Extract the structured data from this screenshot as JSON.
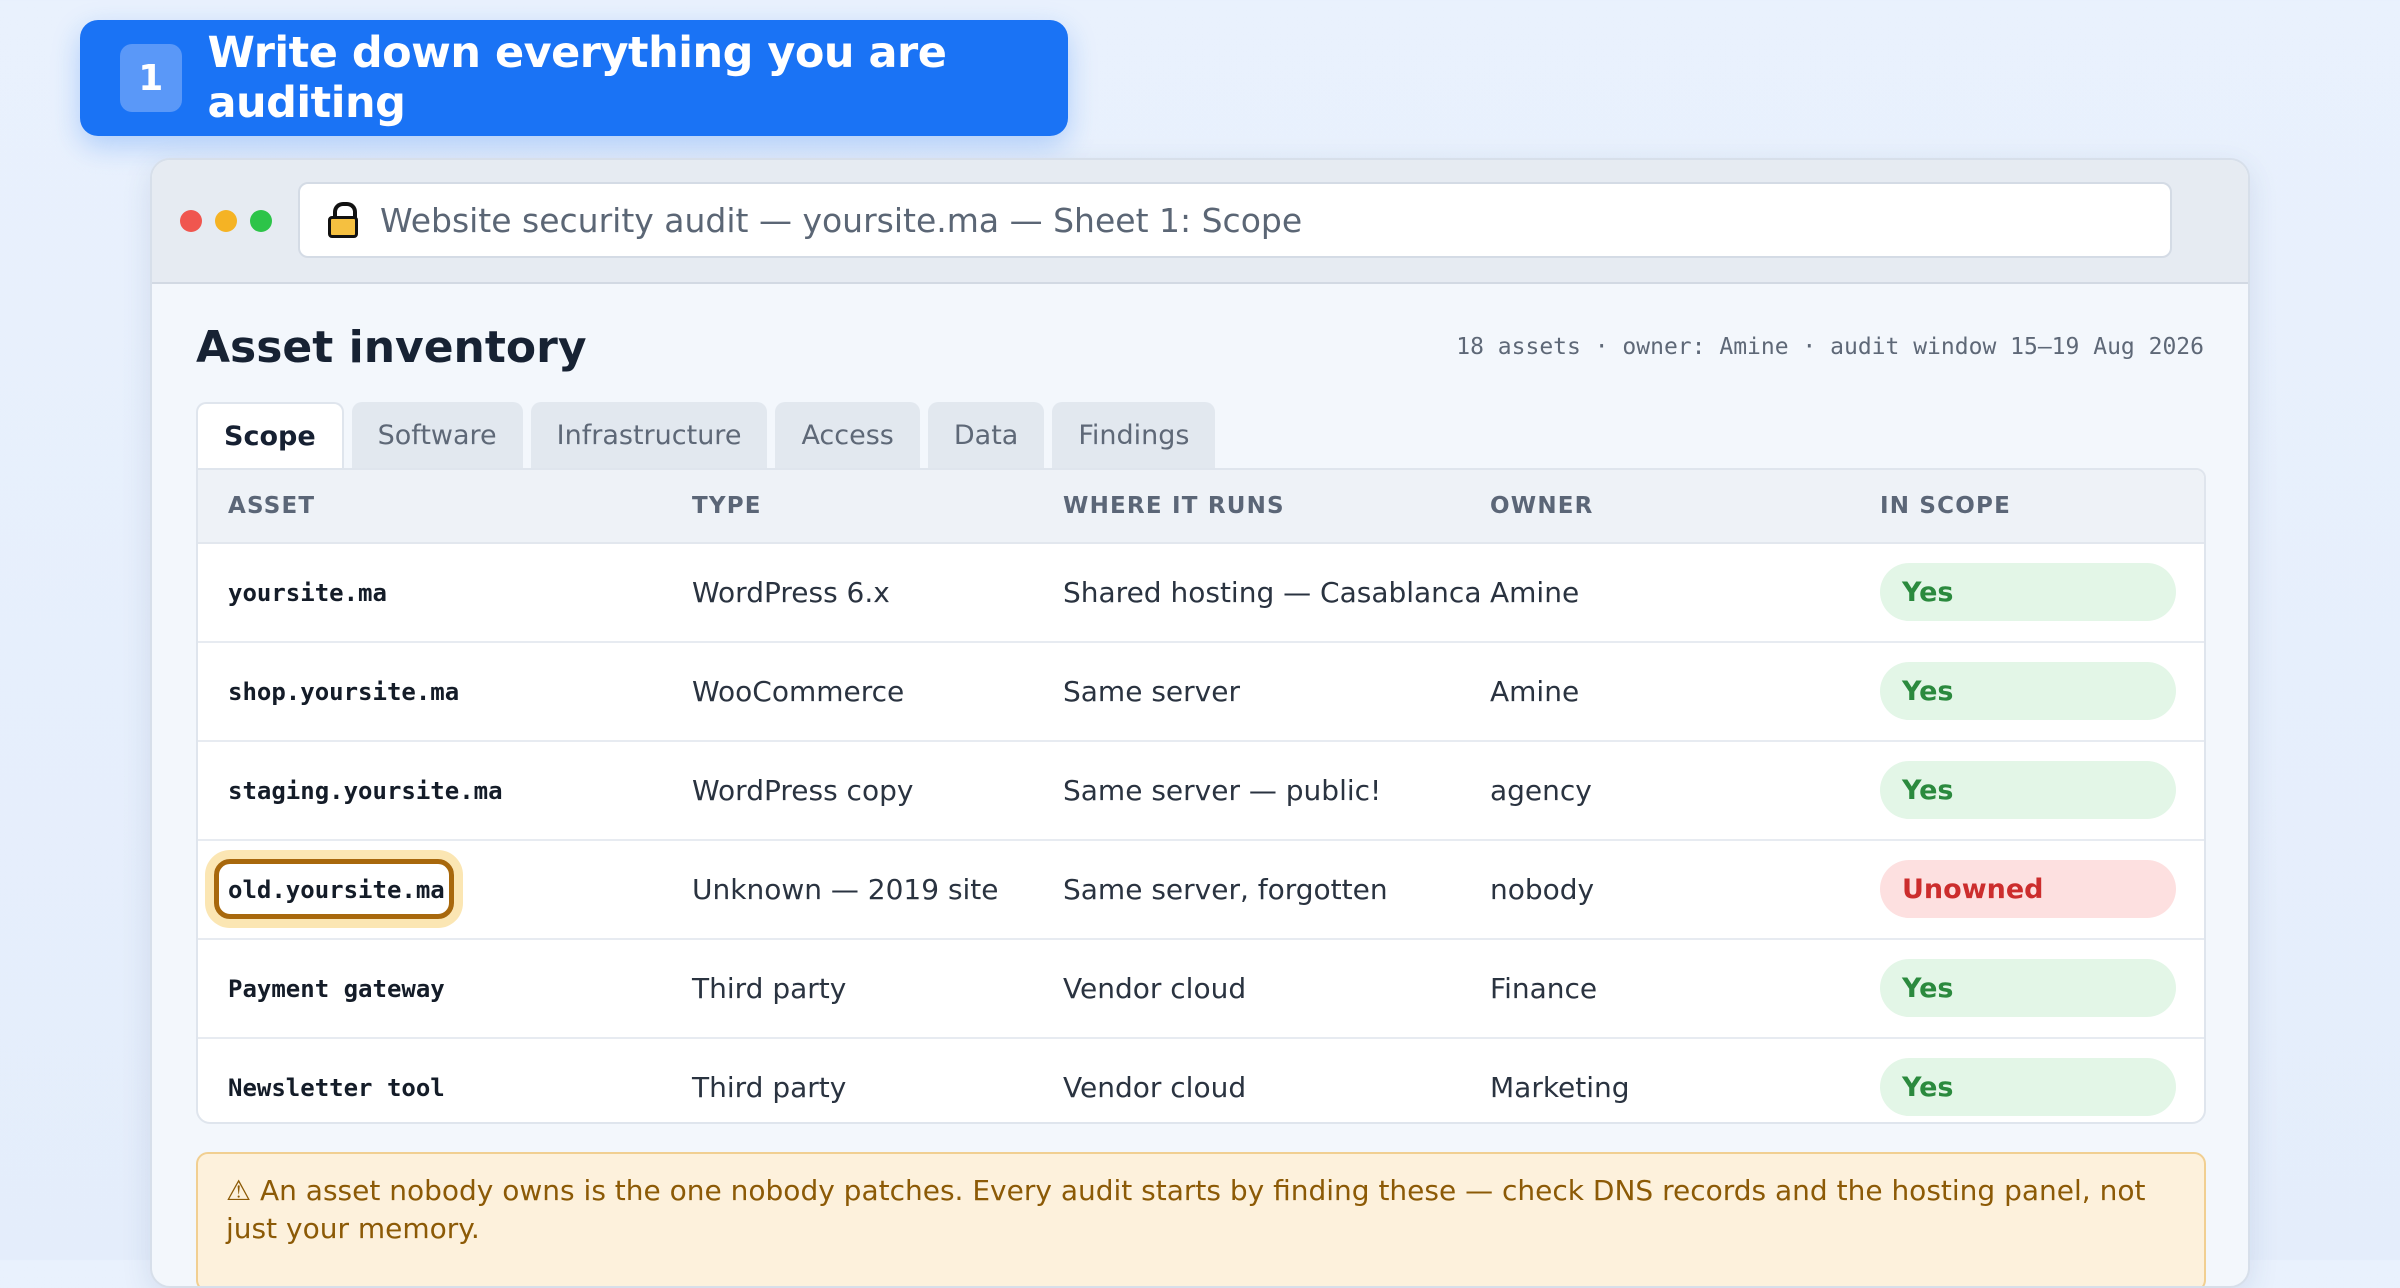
{
  "step": {
    "number": "1",
    "title": "Write down everything you are auditing"
  },
  "window": {
    "address": "Website security audit — yoursite.ma — Sheet 1: Scope"
  },
  "page": {
    "title": "Asset inventory",
    "meta": "18 assets · owner: Amine · audit window 15–19 Aug 2026"
  },
  "tabs": [
    "Scope",
    "Software",
    "Infrastructure",
    "Access",
    "Data",
    "Findings"
  ],
  "table": {
    "headers": [
      "ASSET",
      "TYPE",
      "WHERE IT RUNS",
      "OWNER",
      "IN SCOPE"
    ],
    "rows": [
      {
        "asset": "yoursite.ma",
        "type": "WordPress 6.x",
        "where": "Shared hosting — Casablanca",
        "owner": "Amine",
        "scope": "Yes"
      },
      {
        "asset": "shop.yoursite.ma",
        "type": "WooCommerce",
        "where": "Same server",
        "owner": "Amine",
        "scope": "Yes"
      },
      {
        "asset": "staging.yoursite.ma",
        "type": "WordPress copy",
        "where": "Same server — public!",
        "owner": "agency",
        "scope": "Yes"
      },
      {
        "asset": "old.yoursite.ma",
        "type": "Unknown — 2019 site",
        "where": "Same server, forgotten",
        "owner": "nobody",
        "scope": "Unowned"
      },
      {
        "asset": "Payment gateway",
        "type": "Third party",
        "where": "Vendor cloud",
        "owner": "Finance",
        "scope": "Yes"
      },
      {
        "asset": "Newsletter tool",
        "type": "Third party",
        "where": "Vendor cloud",
        "owner": "Marketing",
        "scope": "Yes"
      }
    ]
  },
  "callout": "⚠ An asset nobody owns is the one nobody patches. Every audit starts by finding these — check DNS records and the hosting panel, not just your memory.",
  "colors": {
    "accent": "#1a73f5",
    "yes": "#2b8a3e",
    "unowned": "#cc2d2d",
    "warning": "#8c5a06"
  }
}
